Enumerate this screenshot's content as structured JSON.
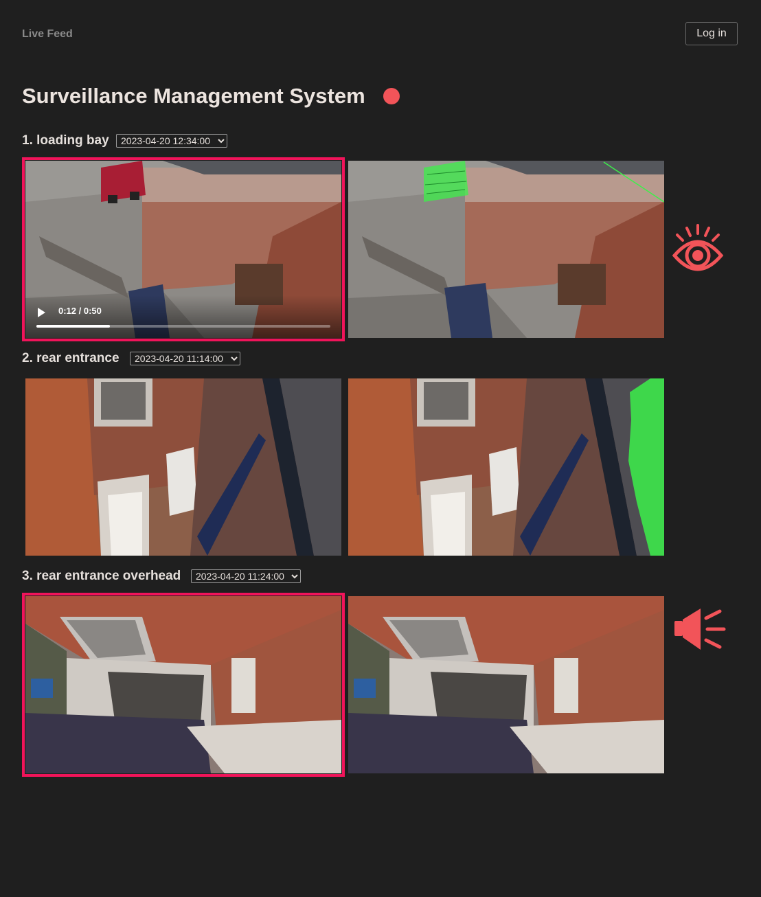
{
  "nav": {
    "brand": "Live Feed",
    "login_label": "Log in"
  },
  "page": {
    "title": "Surveillance Management System",
    "recording_color": "#f25459"
  },
  "cameras": [
    {
      "label": "1. loading bay",
      "timestamp": "2023-04-20 12:34:00",
      "highlighted": true,
      "alert_icon": "eye-icon",
      "video": {
        "time_display": "0:12 / 0:50",
        "progress": 0.25
      }
    },
    {
      "label": "2. rear entrance",
      "timestamp": "2023-04-20 11:14:00",
      "highlighted": false,
      "alert_icon": null
    },
    {
      "label": "3. rear entrance overhead",
      "timestamp": "2023-04-20 11:24:00",
      "highlighted": true,
      "alert_icon": "megaphone-icon"
    }
  ],
  "colors": {
    "highlight": "#f0145a",
    "alert": "#f25459",
    "detection": "#3cf04a"
  }
}
